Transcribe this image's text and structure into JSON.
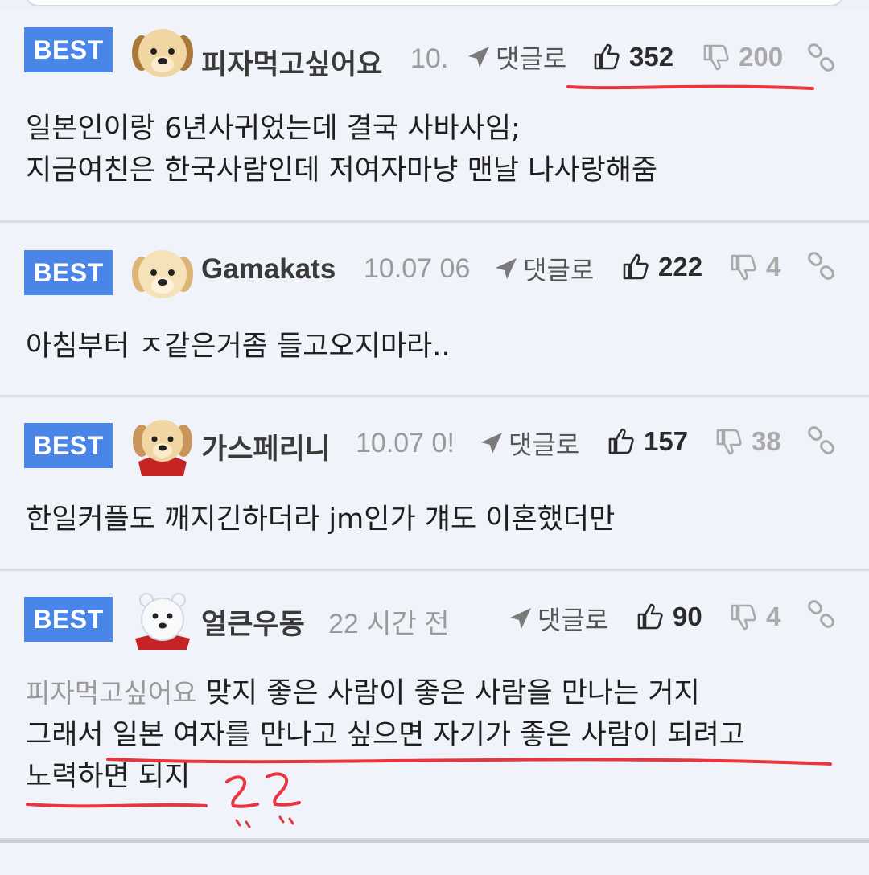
{
  "comments": [
    {
      "badge": "BEST",
      "user": "피자먹고싶어요",
      "time": "10.",
      "reply": "댓글로",
      "likes": "352",
      "dislikes": "200",
      "lines": [
        "일본인이랑 6년사귀었는데 결국 사바사임;",
        "지금여친은 한국사람인데 저여자마냥 맨날 나사랑해줌"
      ]
    },
    {
      "badge": "BEST",
      "user": "Gamakats",
      "time": "10.07 06",
      "reply": "댓글로",
      "likes": "222",
      "dislikes": "4",
      "lines": [
        "아침부터 ㅈ같은거좀 들고오지마라.."
      ]
    },
    {
      "badge": "BEST",
      "user": "가스페리니",
      "time": "10.07 0!",
      "reply": "댓글로",
      "likes": "157",
      "dislikes": "38",
      "lines": [
        "한일커플도 깨지긴하더라 jm인가 걔도 이혼했더만"
      ]
    },
    {
      "badge": "BEST",
      "user": "얼큰우동",
      "time": "22 시간 전",
      "reply": "댓글로",
      "likes": "90",
      "dislikes": "4",
      "mention": "피자먹고싶어요",
      "lines": [
        "맞지 좋은 사람이 좋은 사람을 만나는 거지",
        "그래서 일본 여자를 만나고 싶으면 자기가 좋은 사람이 되려고",
        "노력하면 되지"
      ]
    }
  ],
  "annotation": {
    "handwritten": "ㄹㄹ",
    "color": "#e8353f"
  },
  "colors": {
    "accent": "#4a86e8",
    "background": "#f1f3fb",
    "mark": "#e8353f"
  }
}
